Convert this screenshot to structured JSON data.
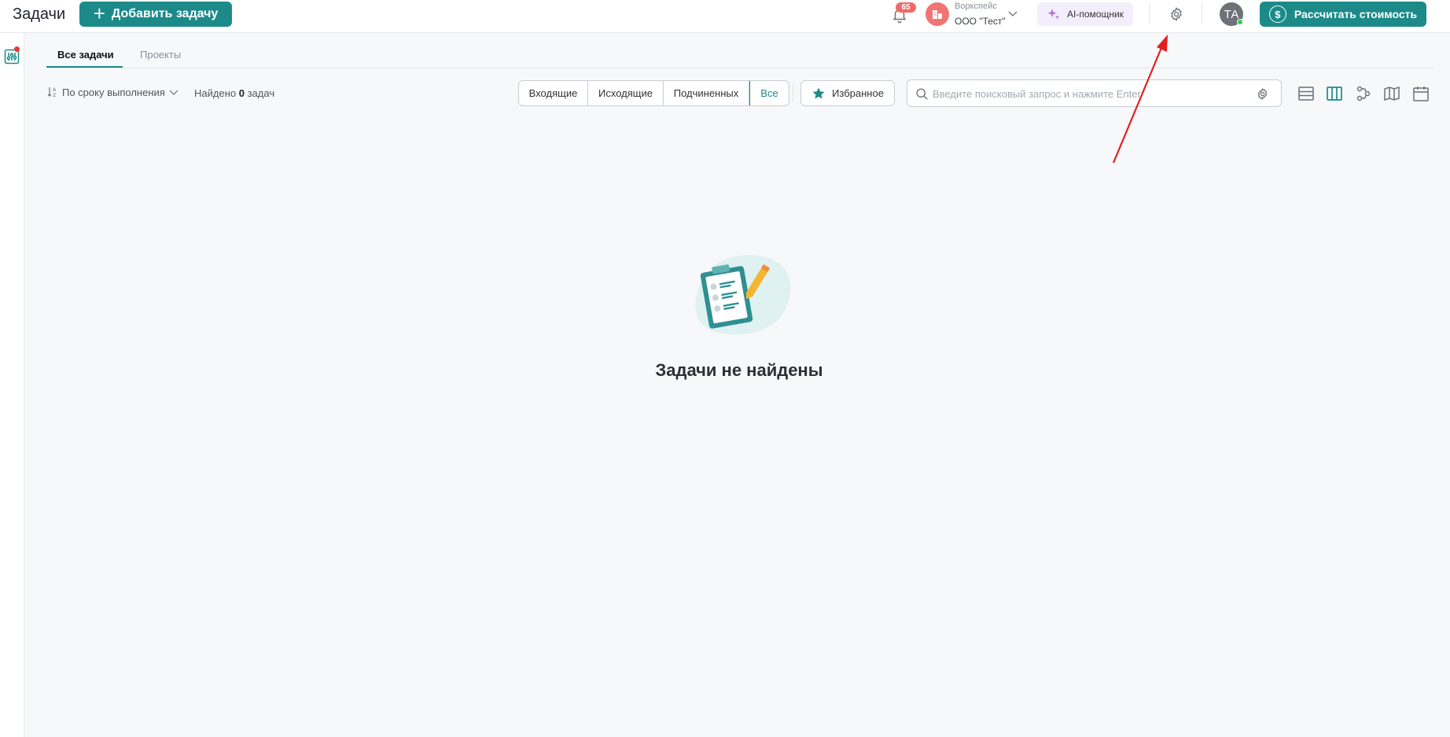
{
  "header": {
    "title": "Задачи",
    "add_task_label": "Добавить задачу",
    "notifications_count": "65",
    "workspace_label": "Воркспейс",
    "workspace_name": "ООО \"Тест\"",
    "ai_label": "AI-помощник",
    "user_initials": "ТА",
    "calc_label": "Рассчитать стоимость",
    "calc_icon_glyph": "$"
  },
  "tabs": [
    {
      "label": "Все задачи",
      "active": true
    },
    {
      "label": "Проекты",
      "active": false
    }
  ],
  "toolbar": {
    "sort_label": "По сроку выполнения",
    "found_prefix": "Найдено",
    "found_count": "0",
    "found_suffix": "задач",
    "filters": [
      {
        "label": "Входящие",
        "active": false
      },
      {
        "label": "Исходящие",
        "active": false
      },
      {
        "label": "Подчиненных",
        "active": false
      },
      {
        "label": "Все",
        "active": true
      }
    ],
    "favorites_label": "Избранное",
    "search_placeholder": "Введите поисковый запрос и нажмите Enter",
    "search_value": ""
  },
  "view_modes": [
    {
      "icon": "list-view-icon",
      "active": false
    },
    {
      "icon": "kanban-view-icon",
      "active": true
    },
    {
      "icon": "flow-view-icon",
      "active": false
    },
    {
      "icon": "map-view-icon",
      "active": false
    },
    {
      "icon": "calendar-view-icon",
      "active": false
    }
  ],
  "empty_state": {
    "title": "Задачи не найдены"
  },
  "colors": {
    "accent": "#1d8a8a",
    "badge": "#f06a6a",
    "annotation_arrow": "#e02020"
  }
}
